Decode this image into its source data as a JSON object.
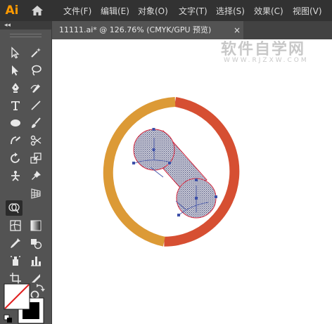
{
  "app": {
    "logo": "Ai"
  },
  "menu": [
    "文件(F)",
    "编辑(E)",
    "对象(O)",
    "文字(T)",
    "选择(S)",
    "效果(C)",
    "视图(V)"
  ],
  "document_tab": {
    "title": "11111.ai* @ 126.76% (CMYK/GPU 预览)",
    "close": "×"
  },
  "watermark": {
    "text": "软件自学网",
    "url": "WWW.RJZXW.COM"
  },
  "toolbar": {
    "collapse": "◂◂",
    "tools": [
      "selection-tool",
      "magic-wand-tool",
      "direct-selection-tool",
      "lasso-tool",
      "pen-tool",
      "curvature-tool",
      "type-tool",
      "line-segment-tool",
      "ellipse-tool",
      "paintbrush-tool",
      "shaper-tool",
      "scissors-tool",
      "rotate-tool",
      "scale-tool",
      "puppet-warp-tool",
      "pin-tool",
      "shape-builder-tool",
      "perspective-grid-tool",
      "mesh-tool",
      "gradient-tool",
      "eyedropper-tool",
      "blend-tool",
      "symbol-sprayer-tool",
      "column-graph-tool",
      "artboard-tool",
      "slice-tool",
      "hand-tool",
      "zoom-tool"
    ]
  },
  "colors": {
    "ring_orange": "#dc9a36",
    "ring_red": "#d64f32",
    "selection": "#d7263d",
    "menubar": "#323232",
    "panel": "#535353",
    "app_logo": "#ff9a00"
  }
}
